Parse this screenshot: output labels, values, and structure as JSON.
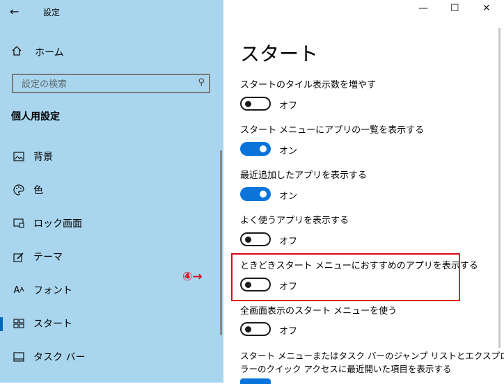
{
  "window": {
    "title": "設定",
    "back_icon": "←",
    "minimize": "—",
    "maximize": "☐",
    "close": "✕"
  },
  "sidebar": {
    "home_label": "ホーム",
    "search_placeholder": "設定の検索",
    "section_title": "個人用設定",
    "items": [
      {
        "label": "背景",
        "icon": "image-icon"
      },
      {
        "label": "色",
        "icon": "palette-icon"
      },
      {
        "label": "ロック画面",
        "icon": "lock-screen-icon"
      },
      {
        "label": "テーマ",
        "icon": "theme-icon"
      },
      {
        "label": "フォント",
        "icon": "font-icon"
      },
      {
        "label": "スタート",
        "icon": "start-icon"
      },
      {
        "label": "タスク バー",
        "icon": "taskbar-icon"
      }
    ]
  },
  "main": {
    "title": "スタート",
    "settings": [
      {
        "label": "スタートのタイル表示数を増やす",
        "state": "オフ",
        "on": false
      },
      {
        "label": "スタート メニューにアプリの一覧を表示する",
        "state": "オン",
        "on": true
      },
      {
        "label": "最近追加したアプリを表示する",
        "state": "オン",
        "on": true
      },
      {
        "label": "よく使うアプリを表示する",
        "state": "オフ",
        "on": false
      },
      {
        "label": "ときどきスタート メニューにおすすめのアプリを表示する",
        "state": "オフ",
        "on": false
      },
      {
        "label": "全画面表示のスタート メニューを使う",
        "state": "オフ",
        "on": false
      }
    ],
    "last_setting_line1": "スタート メニューまたはタスク バーのジャンプ リストとエクスプロー",
    "last_setting_line2": "ラーのクイック アクセスに最近開いた項目を表示する"
  },
  "annotation": {
    "step": "④→",
    "color": "#e0001b"
  },
  "colors": {
    "sidebar_bg": "#a9d6ee",
    "accent": "#0a74da"
  }
}
